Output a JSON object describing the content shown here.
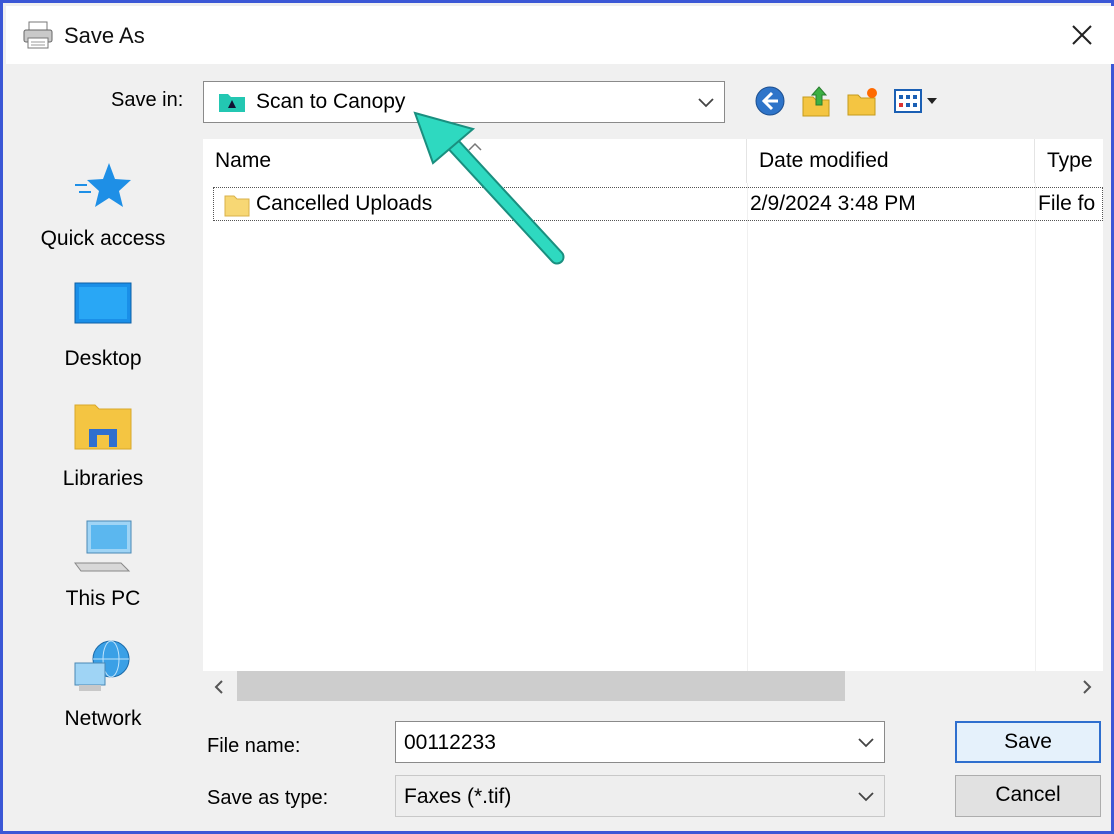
{
  "window": {
    "title": "Save As"
  },
  "save_in": {
    "label": "Save in:",
    "value": "Scan to Canopy"
  },
  "places": [
    {
      "label": "Quick access"
    },
    {
      "label": "Desktop"
    },
    {
      "label": "Libraries"
    },
    {
      "label": "This PC"
    },
    {
      "label": "Network"
    }
  ],
  "list": {
    "columns": [
      "Name",
      "Date modified",
      "Type"
    ],
    "rows": [
      {
        "name": "Cancelled Uploads",
        "date": "2/9/2024 3:48 PM",
        "type": "File fo"
      }
    ]
  },
  "file_name": {
    "label": "File name:",
    "value": "00112233"
  },
  "save_as_type": {
    "label": "Save as type:",
    "value": "Faxes (*.tif)"
  },
  "buttons": {
    "save": "Save",
    "cancel": "Cancel"
  },
  "colors": {
    "accent_border": "#3b57d6",
    "annotation_arrow": "#2ed9c0",
    "default_button": "#2f6fce"
  }
}
